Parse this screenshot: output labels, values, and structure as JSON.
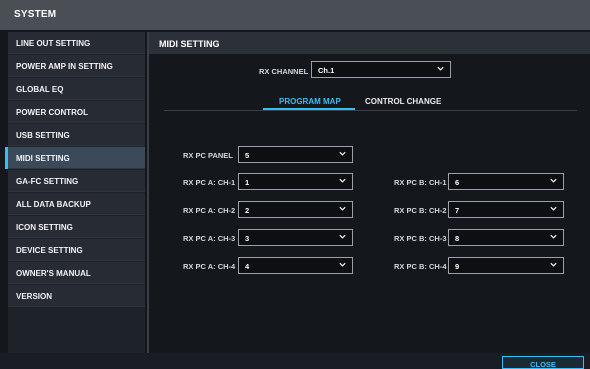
{
  "window": {
    "title": "SYSTEM"
  },
  "sidebar": {
    "items": [
      {
        "label": "LINE OUT SETTING"
      },
      {
        "label": "POWER AMP IN SETTING"
      },
      {
        "label": "GLOBAL EQ"
      },
      {
        "label": "POWER CONTROL"
      },
      {
        "label": "USB SETTING"
      },
      {
        "label": "MIDI SETTING",
        "active": true
      },
      {
        "label": "GA-FC SETTING"
      },
      {
        "label": "ALL DATA BACKUP"
      },
      {
        "label": "ICON SETTING"
      },
      {
        "label": "DEVICE SETTING"
      },
      {
        "label": "OWNER'S MANUAL"
      },
      {
        "label": "VERSION"
      }
    ]
  },
  "panel": {
    "title": "MIDI SETTING",
    "rx_channel": {
      "label": "RX CHANNEL",
      "value": "Ch.1"
    },
    "tabs": [
      {
        "label": "PROGRAM MAP",
        "active": true
      },
      {
        "label": "CONTROL CHANGE",
        "active": false
      }
    ],
    "rx_pc_panel": {
      "label": "RX PC PANEL",
      "value": "5"
    },
    "pc_a": [
      {
        "label": "RX PC A: CH-1",
        "value": "1"
      },
      {
        "label": "RX PC A: CH-2",
        "value": "2"
      },
      {
        "label": "RX PC A: CH-3",
        "value": "3"
      },
      {
        "label": "RX PC A: CH-4",
        "value": "4"
      }
    ],
    "pc_b": [
      {
        "label": "RX PC B: CH-1",
        "value": "6"
      },
      {
        "label": "RX PC B: CH-2",
        "value": "7"
      },
      {
        "label": "RX PC B: CH-3",
        "value": "8"
      },
      {
        "label": "RX PC B: CH-4",
        "value": "9"
      }
    ]
  },
  "footer": {
    "close_label": "CLOSE"
  },
  "colors": {
    "accent": "#38bdf8",
    "background": "#14171c",
    "titlebar": "#4a4e55"
  },
  "icons": {
    "dropdown": "chevron-down-icon"
  }
}
